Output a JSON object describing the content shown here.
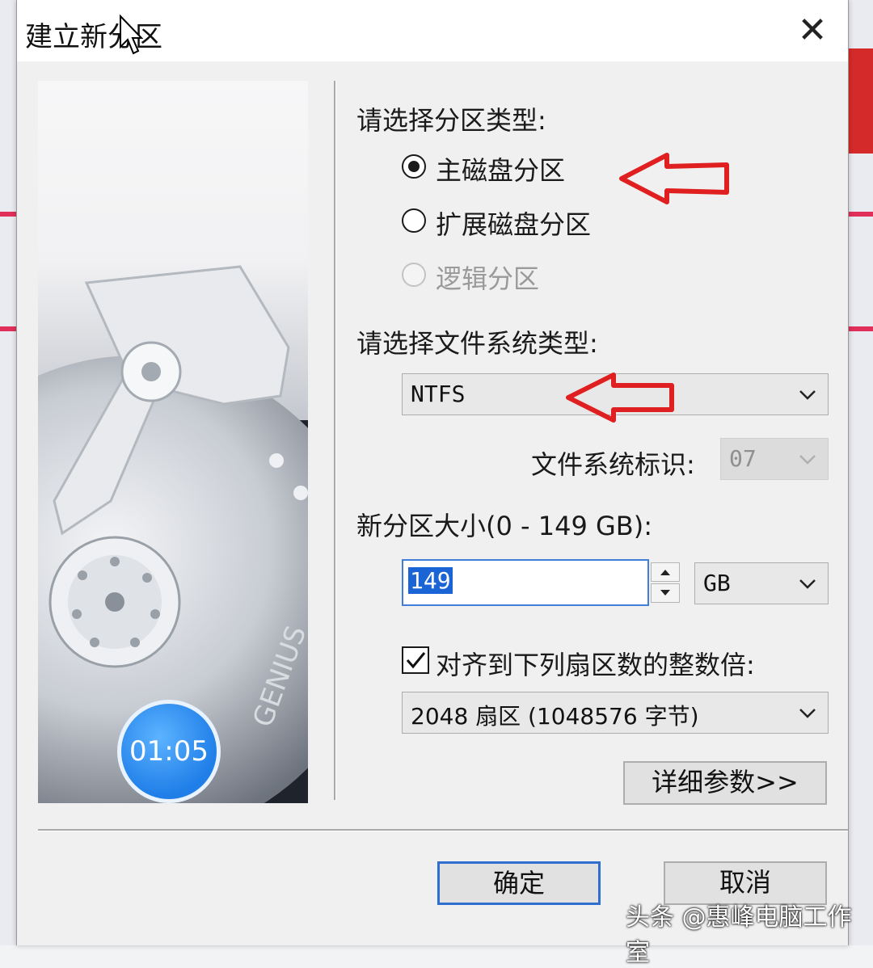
{
  "dialog": {
    "title": "建立新分区",
    "close_label": "✕"
  },
  "partition_type": {
    "heading": "请选择分区类型:",
    "options": [
      {
        "label": "主磁盘分区",
        "checked": true,
        "enabled": true
      },
      {
        "label": "扩展磁盘分区",
        "checked": false,
        "enabled": true
      },
      {
        "label": "逻辑分区",
        "checked": false,
        "enabled": false
      }
    ]
  },
  "file_system": {
    "heading": "请选择文件系统类型:",
    "selected": "NTFS",
    "id_label": "文件系统标识:",
    "id_value": "07"
  },
  "size": {
    "heading": "新分区大小(0 - 149 GB):",
    "value": "149",
    "unit": "GB"
  },
  "alignment": {
    "checkbox_label": "对齐到下列扇区数的整数倍:",
    "checked": true,
    "selected": "2048 扇区 (1048576 字节)"
  },
  "buttons": {
    "details": "详细参数>>",
    "ok": "确定",
    "cancel": "取消"
  },
  "video_timer": "01:05",
  "watermark": "头条 @惠峰电脑工作室",
  "colors": {
    "annotation_arrow": "#e02020",
    "selection": "#1a64d6",
    "timer_badge": "#1f7ee8"
  }
}
